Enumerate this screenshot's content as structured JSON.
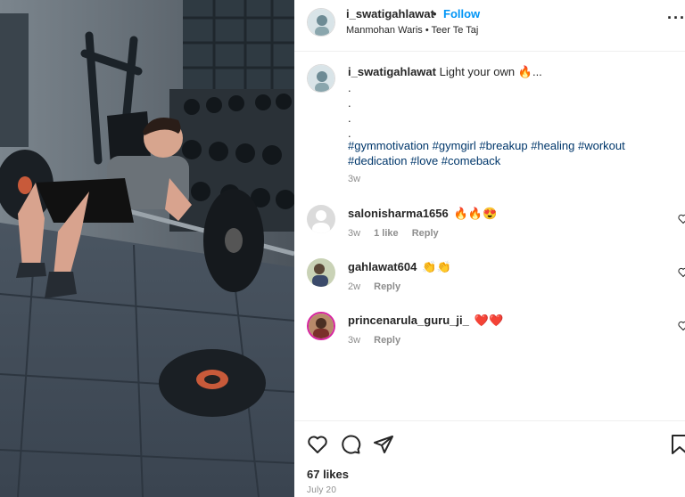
{
  "post": {
    "username": "i_swatigahlawat",
    "separator": "•",
    "follow_label": "Follow",
    "audio": "Manmohan Waris • Teer Te Taj",
    "more_label": "···"
  },
  "caption": {
    "username": "i_swatigahlawat",
    "text": "Light your own 🔥...",
    "dots": [
      ".",
      ".",
      ".",
      "."
    ],
    "hashtags": "#gymmotivation #gymgirl #breakup #healing #workout #dedication #love #comeback",
    "time": "3w"
  },
  "comments": [
    {
      "username": "salonisharma1656",
      "text": "🔥🔥😍",
      "time": "3w",
      "likes": "1 like",
      "reply": "Reply"
    },
    {
      "username": "gahlawat604",
      "text": "👏👏",
      "time": "2w",
      "likes": "",
      "reply": "Reply"
    },
    {
      "username": "princenarula_guru_ji_",
      "text": "❤️❤️",
      "time": "3w",
      "likes": "",
      "reply": "Reply"
    }
  ],
  "footer": {
    "likes": "67 likes",
    "date": "July 20"
  },
  "colors": {
    "link": "#0095f6",
    "hashtag": "#00376b",
    "muted": "#8e8e8e",
    "text": "#262626"
  },
  "icons": [
    "like-icon",
    "comment-icon",
    "share-icon",
    "save-icon",
    "more-icon",
    "comment-like-icon"
  ]
}
